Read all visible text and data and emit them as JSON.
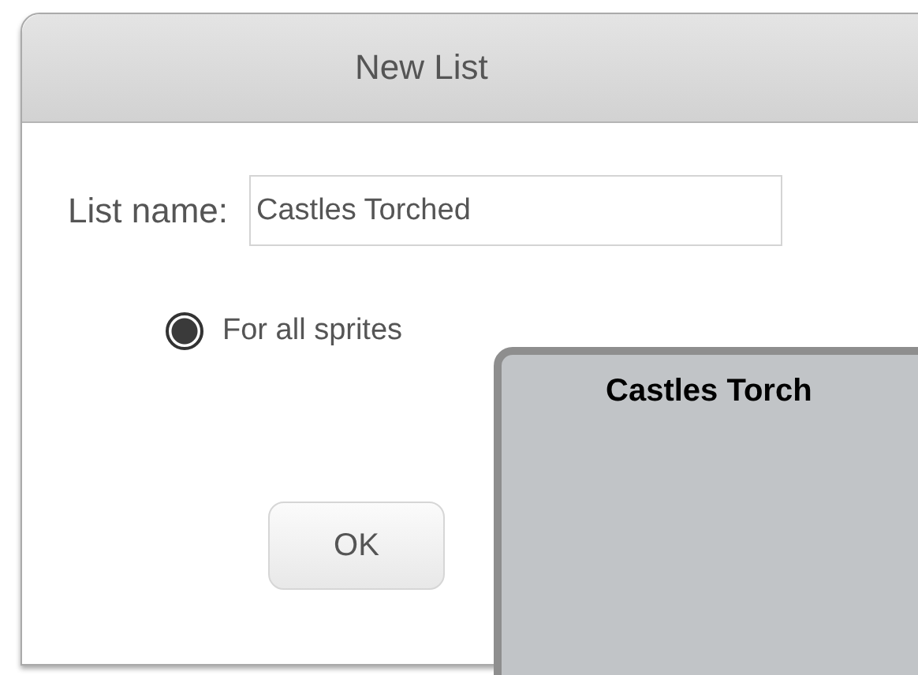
{
  "dialog": {
    "title": "New List",
    "name_label": "List name:",
    "name_value": "Castles Torched",
    "scope_options": [
      {
        "label": "For all sprites",
        "selected": true
      }
    ],
    "buttons": [
      {
        "label": "OK"
      }
    ]
  },
  "list_monitor": {
    "title": "Castles Torch"
  }
}
